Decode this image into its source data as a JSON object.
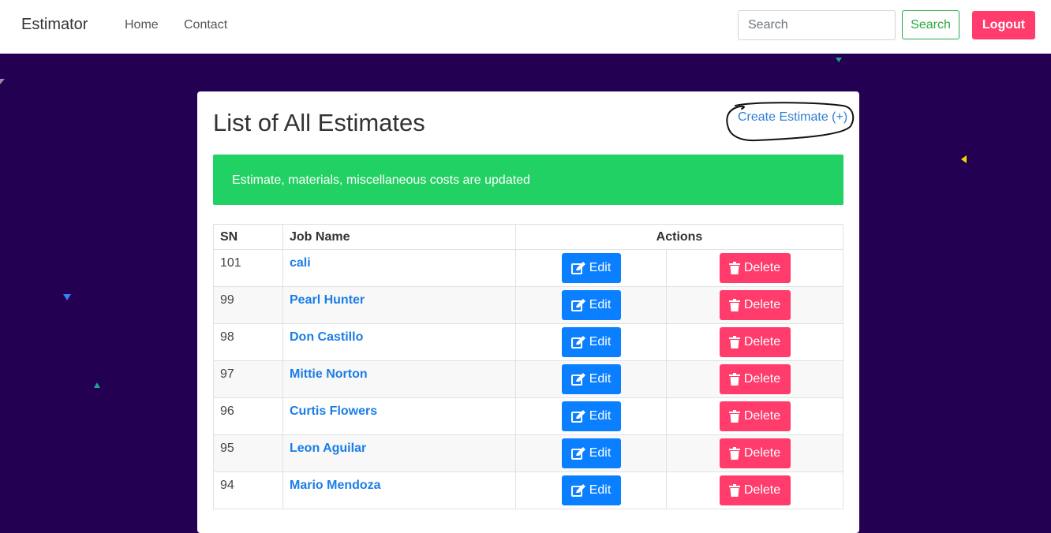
{
  "colors": {
    "page_background": "#240052",
    "accent_blue": "#0a7fff",
    "danger_pink": "#ff3c6b",
    "success_green": "#22d163"
  },
  "navbar": {
    "brand": "Estimator",
    "links": [
      "Home",
      "Contact"
    ],
    "search_placeholder": "Search",
    "search_value": "",
    "search_button": "Search",
    "logout_button": "Logout"
  },
  "card": {
    "title": "List of All Estimates",
    "create_link": "Create Estimate (+)",
    "alert": "Estimate, materials, miscellaneous costs are updated"
  },
  "table": {
    "headers": {
      "sn": "SN",
      "job_name": "Job Name",
      "actions": "Actions"
    },
    "rows": [
      {
        "sn": "101",
        "job": "cali"
      },
      {
        "sn": "99",
        "job": "Pearl Hunter"
      },
      {
        "sn": "98",
        "job": "Don Castillo"
      },
      {
        "sn": "97",
        "job": "Mittie Norton"
      },
      {
        "sn": "96",
        "job": "Curtis Flowers"
      },
      {
        "sn": "95",
        "job": "Leon Aguilar"
      },
      {
        "sn": "94",
        "job": "Mario Mendoza"
      }
    ],
    "edit_label": "Edit",
    "delete_label": "Delete",
    "edit_icon": "edit-icon",
    "delete_icon": "trash-icon"
  }
}
